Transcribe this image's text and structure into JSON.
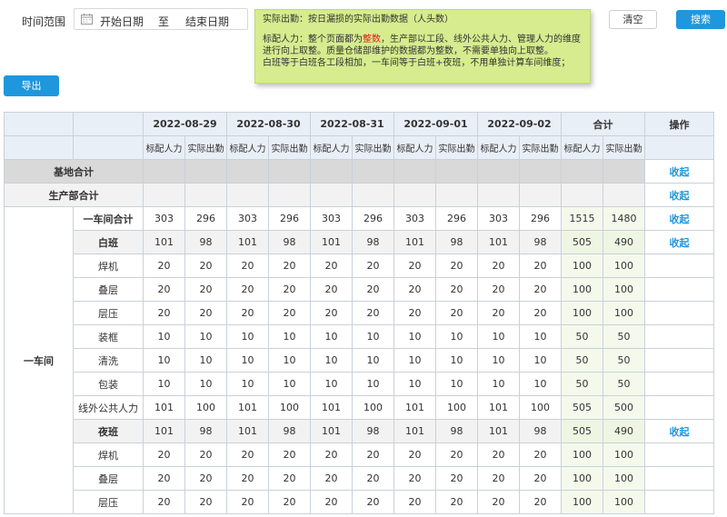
{
  "filter": {
    "label": "时间范围",
    "start_placeholder": "开始日期",
    "separator": "至",
    "end_placeholder": "结束日期"
  },
  "buttons": {
    "clear": "清空",
    "search": "搜索",
    "export": "导出"
  },
  "note": {
    "line1": "实际出勤：按日漏损的实际出勤数据（人头数）",
    "line2_pre": "标配人力：整个页面都为",
    "line2_red": "整数",
    "line2_post": "，生产部以工段、线外公共人力、管理人力的维度",
    "line3": "进行向上取整。质量仓储部维护的数据都为整数，不需要单独向上取整。",
    "line4": "白班等于白班各工段相加，一车间等于白班+夜班，不用单独计算车间维度；"
  },
  "colors": {
    "accent": "#1f97dc",
    "note_bg": "#d6ec8e",
    "header_bg": "#e9eff7"
  },
  "table": {
    "dates": [
      "2022-08-29",
      "2022-08-30",
      "2022-08-31",
      "2022-09-01",
      "2022-09-02"
    ],
    "total_header": "合计",
    "op_header": "操作",
    "sub_headers": [
      "标配人力",
      "实际出勤"
    ],
    "collapse_label": "收起",
    "base_total": "基地合计",
    "prod_total": "生产部合计",
    "workshop": "一车间",
    "rows": [
      {
        "name": "一车间合计",
        "kind": "ws-total",
        "vals": [
          "303",
          "296",
          "303",
          "296",
          "303",
          "296",
          "303",
          "296",
          "303",
          "296",
          "1515",
          "1480"
        ],
        "op": true
      },
      {
        "name": "白班",
        "kind": "shift",
        "vals": [
          "101",
          "98",
          "101",
          "98",
          "101",
          "98",
          "101",
          "98",
          "101",
          "98",
          "505",
          "490"
        ],
        "op": true
      },
      {
        "name": "焊机",
        "kind": "item",
        "vals": [
          "20",
          "20",
          "20",
          "20",
          "20",
          "20",
          "20",
          "20",
          "20",
          "20",
          "100",
          "100"
        ],
        "op": false
      },
      {
        "name": "叠层",
        "kind": "item",
        "vals": [
          "20",
          "20",
          "20",
          "20",
          "20",
          "20",
          "20",
          "20",
          "20",
          "20",
          "100",
          "100"
        ],
        "op": false
      },
      {
        "name": "层压",
        "kind": "item",
        "vals": [
          "20",
          "20",
          "20",
          "20",
          "20",
          "20",
          "20",
          "20",
          "20",
          "20",
          "100",
          "100"
        ],
        "op": false
      },
      {
        "name": "装框",
        "kind": "item",
        "vals": [
          "10",
          "10",
          "10",
          "10",
          "10",
          "10",
          "10",
          "10",
          "10",
          "10",
          "50",
          "50"
        ],
        "op": false
      },
      {
        "name": "清洗",
        "kind": "item",
        "vals": [
          "10",
          "10",
          "10",
          "10",
          "10",
          "10",
          "10",
          "10",
          "10",
          "10",
          "50",
          "50"
        ],
        "op": false
      },
      {
        "name": "包装",
        "kind": "item",
        "vals": [
          "10",
          "10",
          "10",
          "10",
          "10",
          "10",
          "10",
          "10",
          "10",
          "10",
          "50",
          "50"
        ],
        "op": false
      },
      {
        "name": "线外公共人力",
        "kind": "item",
        "vals": [
          "101",
          "100",
          "101",
          "100",
          "101",
          "100",
          "101",
          "100",
          "101",
          "100",
          "505",
          "500"
        ],
        "op": false
      },
      {
        "name": "夜班",
        "kind": "shift",
        "vals": [
          "101",
          "98",
          "101",
          "98",
          "101",
          "98",
          "101",
          "98",
          "101",
          "98",
          "505",
          "490"
        ],
        "op": true
      },
      {
        "name": "焊机",
        "kind": "item",
        "vals": [
          "20",
          "20",
          "20",
          "20",
          "20",
          "20",
          "20",
          "20",
          "20",
          "20",
          "100",
          "100"
        ],
        "op": false
      },
      {
        "name": "叠层",
        "kind": "item",
        "vals": [
          "20",
          "20",
          "20",
          "20",
          "20",
          "20",
          "20",
          "20",
          "20",
          "20",
          "100",
          "100"
        ],
        "op": false
      },
      {
        "name": "层压",
        "kind": "item",
        "vals": [
          "20",
          "20",
          "20",
          "20",
          "20",
          "20",
          "20",
          "20",
          "20",
          "20",
          "100",
          "100"
        ],
        "op": false
      }
    ]
  }
}
